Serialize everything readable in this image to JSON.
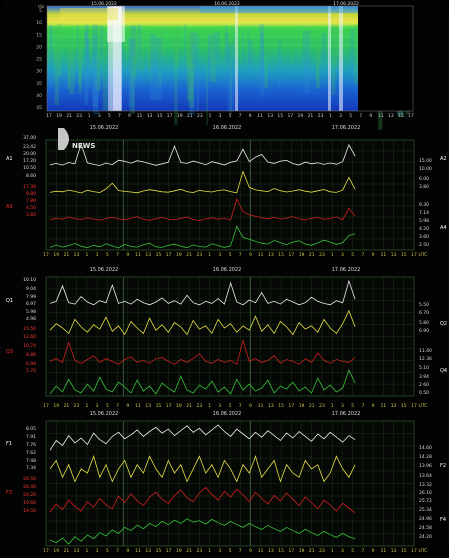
{
  "chart_data": [
    {
      "type": "heatmap",
      "title": "",
      "y_ticks": [
        "5",
        "10",
        "15",
        "20",
        "25",
        "30",
        "35",
        "40",
        "45"
      ],
      "x_ticks": [
        "17",
        "19",
        "21",
        "23",
        "1",
        "3",
        "5",
        "7",
        "9",
        "11",
        "13",
        "15",
        "17",
        "19",
        "21",
        "23",
        "1",
        "3",
        "5",
        "7",
        "9",
        "11",
        "13",
        "15",
        "17",
        "19",
        "21",
        "23",
        "1",
        "3",
        "5",
        "7",
        "9",
        "11",
        "13",
        "15",
        "17"
      ],
      "top_labels": [
        "15.06.2022",
        "16.06.2022",
        "17.06.2022"
      ],
      "dates": [
        "15.06.2022",
        "16.06.2022",
        "17.06.2022"
      ],
      "y_unit": "Hz"
    },
    {
      "type": "line",
      "dates": [
        "15.06.2022",
        "16.06.2022",
        "17.06.2022"
      ],
      "left_axes": [
        {
          "name": "A1",
          "color": "#ffffff",
          "ticks": [
            "37.00",
            "23.42",
            "20.00",
            "17.20",
            "10.50",
            "8.60"
          ]
        },
        {
          "name": "A3",
          "color": "#ff2a2a",
          "ticks": [
            "17.30",
            "9.80",
            "7.80",
            "4.50",
            "3.60"
          ]
        }
      ],
      "right_axes": [
        {
          "name": "A2",
          "color": "#ffffff",
          "ticks": [
            "15.00",
            "10.00",
            "6.00",
            "3.80"
          ]
        },
        {
          "name": "A4",
          "color": "#ffffff",
          "ticks": [
            "9.30",
            "7.14",
            "5.98",
            "4.20",
            "3.60",
            "2.50"
          ]
        }
      ],
      "x_ticks": [
        "17",
        "19",
        "21",
        "23",
        "1",
        "3",
        "5",
        "7",
        "9",
        "11",
        "13",
        "15",
        "17",
        "19",
        "21",
        "23",
        "1",
        "3",
        "5",
        "7",
        "9",
        "11",
        "13",
        "15",
        "17",
        "19",
        "21",
        "23",
        "1",
        "3",
        "5",
        "7",
        "9",
        "11",
        "13",
        "15",
        "17"
      ],
      "x_unit": "UTC",
      "series": [
        {
          "color": "#ececec",
          "values": [
            24.1,
            24.8,
            24.0,
            25.2,
            24.6,
            34.0,
            25.1,
            24.3,
            23.8,
            25.0,
            24.2,
            26.3,
            25.8,
            24.9,
            26.1,
            25.5,
            24.7,
            23.9,
            24.6,
            25.3,
            33.0,
            25.2,
            24.8,
            25.9,
            25.1,
            24.2,
            25.6,
            24.9,
            24.1,
            25.3,
            26.0,
            31.5,
            25.6,
            27.8,
            29.0,
            25.4,
            24.8,
            25.9,
            26.2,
            24.7,
            24.1,
            25.4,
            24.6,
            25.1,
            24.3,
            25.0,
            24.4,
            25.6,
            33.6,
            28.2
          ]
        },
        {
          "color": "#e6df45",
          "values": [
            17.8,
            18.4,
            18.1,
            19.0,
            18.3,
            17.5,
            18.9,
            18.2,
            17.7,
            19.6,
            22.5,
            18.8,
            18.3,
            18.0,
            17.6,
            18.5,
            19.2,
            18.7,
            18.1,
            17.9,
            18.6,
            19.4,
            18.2,
            17.7,
            18.9,
            18.3,
            18.0,
            18.8,
            19.1,
            18.2,
            17.6,
            28.5,
            20.4,
            19.1,
            18.6,
            18.2,
            19.8,
            18.7,
            18.0,
            18.5,
            19.2,
            18.4,
            17.9,
            18.6,
            19.3,
            18.1,
            17.8,
            19.0,
            25.5,
            19.4
          ]
        },
        {
          "color": "#cc2020",
          "values": [
            10.1,
            10.8,
            10.3,
            11.5,
            10.6,
            10.2,
            11.0,
            10.4,
            9.9,
            10.7,
            11.3,
            10.5,
            10.1,
            10.9,
            11.6,
            10.3,
            9.8,
            10.6,
            11.2,
            10.4,
            10.0,
            10.8,
            11.4,
            10.2,
            9.7,
            10.5,
            11.1,
            10.3,
            10.9,
            10.0,
            20.5,
            14.2,
            12.6,
            11.8,
            11.0,
            10.6,
            11.3,
            10.4,
            10.9,
            11.7,
            10.5,
            10.0,
            10.8,
            11.2,
            10.3,
            10.7,
            11.5,
            10.1,
            15.8,
            11.9
          ]
        },
        {
          "color": "#39c13b",
          "values": [
            2.8,
            3.6,
            2.9,
            3.4,
            4.1,
            3.2,
            2.7,
            3.5,
            3.0,
            4.0,
            3.3,
            2.6,
            3.8,
            3.1,
            2.9,
            3.7,
            4.2,
            3.0,
            2.8,
            3.5,
            3.9,
            3.2,
            2.7,
            3.6,
            3.1,
            2.9,
            4.0,
            3.4,
            2.8,
            3.3,
            9.8,
            6.2,
            5.5,
            4.8,
            4.2,
            3.9,
            5.1,
            4.4,
            3.7,
            4.6,
            5.0,
            3.9,
            3.5,
            4.3,
            5.2,
            4.6,
            3.8,
            4.4,
            6.8,
            7.4
          ]
        }
      ]
    },
    {
      "type": "line",
      "dates": [
        "15.06.2022",
        "16.06.2022",
        "17.06.2022"
      ],
      "left_axes": [
        {
          "name": "Q1",
          "color": "#ffffff",
          "ticks": [
            "10.10",
            "9.04",
            "7.99",
            "6.97",
            "5.98",
            "4.98"
          ]
        },
        {
          "name": "Q3",
          "color": "#ff2a2a",
          "ticks": [
            "15.50",
            "12.60",
            "10.74",
            "8.86",
            "6.94",
            "5.70"
          ]
        }
      ],
      "right_axes": [
        {
          "name": "Q2",
          "color": "#ffffff",
          "ticks": [
            "5.50",
            "6.70",
            "5.80",
            "6.90"
          ]
        },
        {
          "name": "Q4",
          "color": "#ffffff",
          "ticks": [
            "11.40",
            "12.36",
            "5.10",
            "3.94",
            "2.60",
            "0.50"
          ]
        }
      ],
      "x_ticks": [
        "17",
        "19",
        "21",
        "23",
        "1",
        "3",
        "5",
        "7",
        "9",
        "11",
        "13",
        "15",
        "17",
        "19",
        "21",
        "23",
        "1",
        "3",
        "5",
        "7",
        "9",
        "11",
        "13",
        "15",
        "17",
        "19",
        "21",
        "23",
        "1",
        "3",
        "5",
        "7",
        "9",
        "11",
        "13",
        "15",
        "17"
      ],
      "x_unit": "UTC",
      "series": [
        {
          "color": "#ececec",
          "values": [
            6.2,
            6.5,
            8.8,
            6.3,
            6.1,
            7.2,
            6.4,
            6.0,
            6.6,
            6.3,
            8.9,
            6.2,
            6.5,
            6.1,
            6.8,
            6.3,
            6.0,
            6.4,
            7.0,
            6.2,
            6.6,
            6.1,
            7.4,
            6.3,
            6.0,
            6.5,
            6.2,
            6.9,
            6.1,
            9.2,
            6.4,
            6.0,
            6.7,
            6.3,
            7.8,
            6.2,
            6.5,
            6.1,
            6.8,
            6.4,
            6.0,
            6.3,
            7.1,
            6.5,
            6.2,
            6.0,
            6.6,
            6.3,
            9.5,
            6.8
          ]
        },
        {
          "color": "#e6df45",
          "values": [
            4.6,
            5.2,
            4.8,
            4.3,
            5.6,
            4.9,
            4.4,
            5.1,
            4.7,
            5.8,
            4.5,
            5.0,
            4.2,
            5.4,
            4.8,
            4.3,
            5.7,
            4.6,
            5.1,
            4.4,
            5.3,
            4.9,
            4.2,
            5.5,
            4.7,
            5.0,
            4.3,
            5.6,
            4.8,
            5.2,
            4.4,
            5.0,
            4.6,
            5.9,
            4.5,
            5.1,
            4.3,
            5.4,
            4.9,
            4.2,
            5.3,
            4.7,
            5.0,
            4.4,
            5.6,
            4.8,
            4.3,
            5.2,
            6.4,
            4.9
          ]
        },
        {
          "color": "#cc2020",
          "values": [
            10.6,
            10.9,
            10.5,
            12.6,
            10.7,
            10.4,
            10.8,
            11.2,
            10.5,
            10.9,
            10.6,
            10.3,
            10.8,
            11.1,
            10.5,
            10.7,
            10.4,
            10.9,
            11.0,
            10.6,
            10.3,
            10.8,
            10.5,
            10.9,
            11.4,
            10.6,
            10.4,
            10.8,
            10.5,
            10.7,
            10.3,
            12.8,
            10.6,
            10.9,
            10.5,
            10.7,
            11.2,
            10.4,
            10.8,
            10.6,
            10.3,
            10.9,
            10.5,
            11.5,
            10.7,
            10.4,
            10.8,
            10.6,
            10.5,
            11.0
          ]
        },
        {
          "color": "#39c13b",
          "values": [
            2.1,
            2.9,
            2.3,
            3.6,
            2.5,
            2.2,
            3.1,
            2.4,
            3.8,
            2.6,
            2.3,
            3.3,
            2.8,
            2.2,
            3.5,
            2.4,
            2.9,
            2.1,
            3.2,
            2.7,
            2.3,
            3.9,
            2.5,
            2.2,
            3.0,
            2.6,
            3.4,
            2.3,
            2.8,
            2.1,
            3.6,
            2.5,
            3.1,
            2.4,
            2.7,
            3.5,
            2.2,
            2.9,
            2.6,
            3.3,
            2.4,
            2.8,
            2.2,
            3.7,
            2.5,
            3.0,
            2.3,
            2.7,
            4.5,
            3.2
          ]
        }
      ]
    },
    {
      "type": "line",
      "dates": [
        "15.06.2022",
        "16.06.2022",
        "17.06.2022"
      ],
      "left_axes": [
        {
          "name": "F1",
          "color": "#ffffff",
          "ticks": [
            "8.05",
            "7.91",
            "7.76",
            "7.62",
            "7.48",
            "7.34"
          ]
        },
        {
          "name": "F3",
          "color": "#ff2a2a",
          "ticks": [
            "20.50",
            "20.40",
            "20.20",
            "19.60",
            "19.50"
          ]
        }
      ],
      "right_axes": [
        {
          "name": "F2",
          "color": "#ffffff",
          "ticks": [
            "14.60",
            "14.28",
            "13.96",
            "13.64",
            "13.32"
          ]
        },
        {
          "name": "F4",
          "color": "#ffffff",
          "ticks": [
            "26.10",
            "25.72",
            "25.34",
            "24.96",
            "24.58",
            "24.20"
          ]
        }
      ],
      "x_ticks": [
        "17",
        "19",
        "21",
        "23",
        "1",
        "3",
        "5",
        "7",
        "9",
        "11",
        "13",
        "15",
        "17",
        "19",
        "21",
        "23",
        "1",
        "3",
        "5",
        "7",
        "9",
        "11",
        "13",
        "15",
        "17",
        "19",
        "21",
        "23",
        "1",
        "3",
        "5",
        "7",
        "9",
        "11",
        "13",
        "15",
        "17"
      ],
      "x_unit": "UTC",
      "series": [
        {
          "color": "#ececec",
          "values": [
            7.62,
            7.74,
            7.68,
            7.8,
            7.71,
            7.77,
            7.69,
            7.83,
            7.75,
            7.7,
            7.79,
            7.84,
            7.76,
            7.81,
            7.87,
            7.79,
            7.85,
            7.9,
            7.83,
            7.88,
            7.8,
            7.86,
            7.92,
            7.84,
            7.89,
            7.81,
            7.87,
            7.93,
            7.85,
            7.79,
            7.88,
            7.82,
            7.76,
            7.84,
            7.78,
            7.86,
            7.8,
            7.74,
            7.83,
            7.77,
            7.85,
            7.79,
            7.73,
            7.82,
            7.76,
            7.84,
            7.78,
            7.72,
            7.8,
            7.75
          ]
        },
        {
          "color": "#e6df45",
          "values": [
            13.9,
            14.1,
            13.7,
            14.0,
            13.6,
            13.9,
            13.8,
            14.2,
            13.7,
            14.0,
            13.6,
            13.9,
            14.1,
            13.7,
            14.0,
            13.8,
            14.2,
            13.9,
            13.7,
            14.1,
            13.8,
            14.0,
            13.6,
            13.9,
            14.2,
            13.8,
            14.0,
            13.7,
            14.1,
            13.9,
            13.6,
            14.0,
            13.8,
            14.2,
            13.7,
            13.9,
            14.1,
            13.6,
            14.0,
            13.8,
            13.7,
            14.1,
            13.9,
            14.0,
            13.6,
            13.8,
            14.2,
            13.9,
            13.7,
            14.0
          ]
        },
        {
          "color": "#cc2020",
          "values": [
            19.95,
            20.05,
            19.98,
            20.1,
            20.02,
            19.96,
            20.08,
            20.01,
            20.12,
            20.04,
            19.99,
            20.15,
            20.07,
            20.18,
            20.09,
            20.03,
            20.14,
            20.2,
            20.11,
            20.06,
            20.16,
            20.23,
            20.13,
            20.08,
            20.19,
            20.26,
            20.17,
            20.1,
            20.21,
            20.14,
            20.24,
            20.17,
            20.08,
            20.2,
            20.12,
            20.05,
            20.16,
            20.09,
            20.19,
            20.11,
            20.03,
            20.14,
            20.07,
            19.99,
            20.1,
            20.04,
            19.96,
            20.06,
            20.0,
            19.94
          ]
        },
        {
          "color": "#39c13b",
          "values": [
            24.8,
            24.72,
            24.86,
            24.68,
            24.9,
            24.76,
            24.95,
            24.84,
            25.02,
            24.92,
            25.1,
            25.0,
            25.18,
            25.08,
            25.25,
            25.14,
            25.3,
            25.2,
            25.36,
            25.26,
            25.4,
            25.3,
            25.44,
            25.34,
            25.38,
            25.28,
            25.42,
            25.32,
            25.24,
            25.36,
            25.26,
            25.18,
            25.3,
            25.2,
            25.12,
            25.24,
            25.14,
            25.06,
            25.18,
            25.08,
            25.0,
            25.12,
            25.02,
            24.94,
            25.06,
            24.96,
            24.88,
            25.0,
            24.9,
            24.84
          ]
        }
      ]
    }
  ],
  "watermark": "NEWS"
}
